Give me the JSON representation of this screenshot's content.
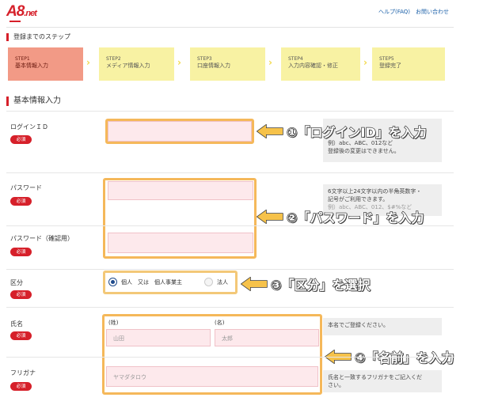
{
  "header": {
    "logo": "A8",
    "logo_suffix": ".net",
    "help_link": "ヘルプ(FAQ)",
    "contact_link": "お問い合わせ"
  },
  "steps_title": "登録までのステップ",
  "steps": [
    {
      "num": "STEP1",
      "label": "基本情報入力",
      "active": true
    },
    {
      "num": "STEP2",
      "label": "メディア情報入力",
      "active": false
    },
    {
      "num": "STEP3",
      "label": "口座情報入力",
      "active": false
    },
    {
      "num": "STEP4",
      "label": "入力内容確認・修正",
      "active": false
    },
    {
      "num": "STEP5",
      "label": "登録完了",
      "active": false
    }
  ],
  "section_title": "基本情報入力",
  "required_label": "必須",
  "fields": {
    "login_id": {
      "label": "ログインＩＤ"
    },
    "password": {
      "label": "パスワード"
    },
    "password_confirm": {
      "label": "パスワード（確認用）"
    },
    "category": {
      "label": "区分",
      "option_individual": "個人　又は　個人事業主",
      "option_corp": "法人"
    },
    "name": {
      "label": "氏名",
      "last_sublabel": "(姓)",
      "first_sublabel": "(名)",
      "last_placeholder": "山田",
      "first_placeholder": "太郎"
    },
    "furigana": {
      "label": "フリガナ",
      "placeholder": "ヤマダタロウ"
    }
  },
  "notes": {
    "login_id": [
      "例）abc、ABC、012など",
      "登録後の変更はできません。"
    ],
    "password": [
      "6文字以上24文字以内の半角英数字・",
      "記号がご利用できます。",
      "例）abc、ABC、012、$#%など"
    ],
    "name": [
      "本名でご登録ください。"
    ],
    "furigana": [
      "氏名と一致するフリガナをご記入くだ",
      "さい。"
    ]
  },
  "callouts": {
    "login_id": "①「ログインID」を入力",
    "password": "②「パスワード」を入力",
    "category": "③「区分」を選択",
    "name": "④「名前」を入力"
  },
  "colors": {
    "brand_red": "#d6202a",
    "step_active": "#f29a86",
    "step_inactive": "#f8f2a3",
    "highlight": "#f3c878",
    "input_bg": "#fde9ec"
  }
}
